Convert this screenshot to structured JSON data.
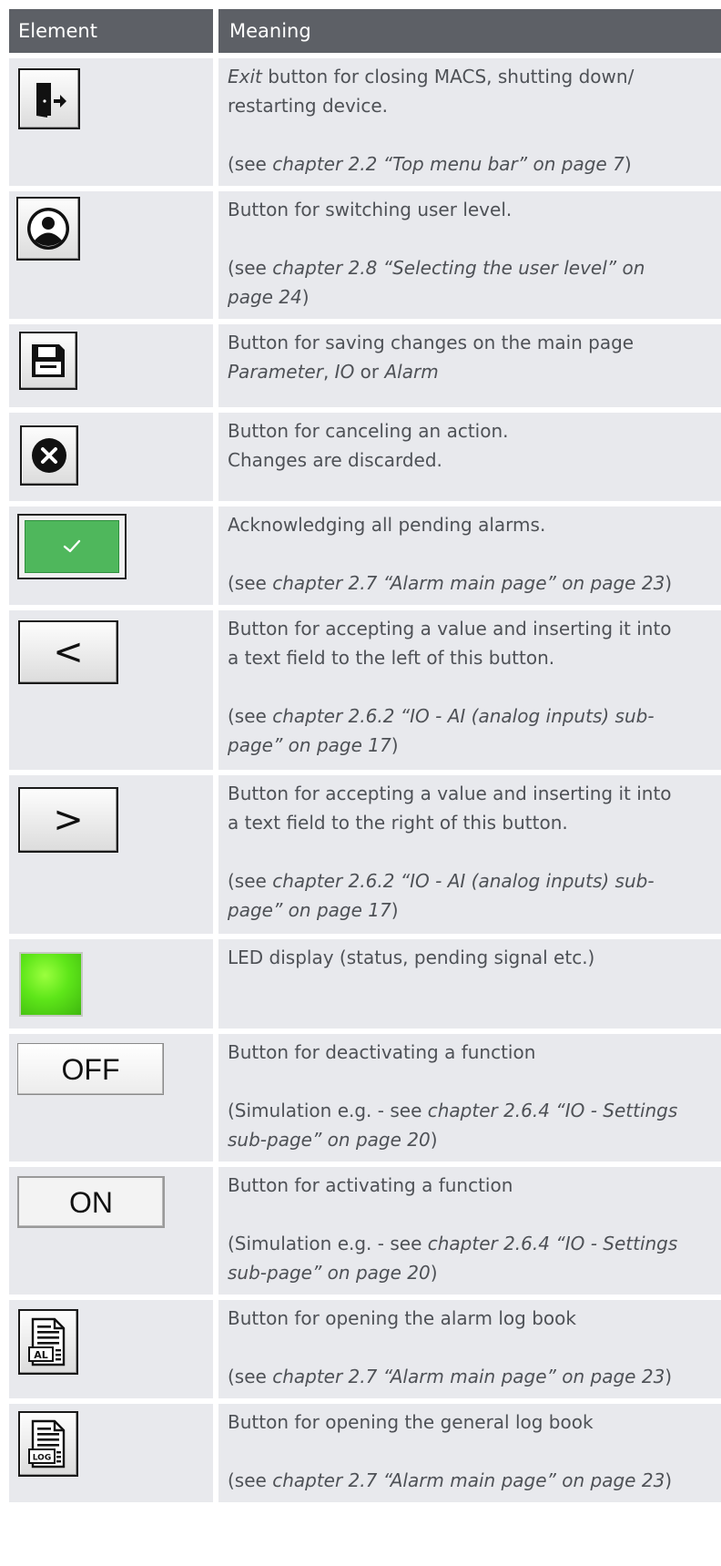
{
  "header": {
    "col_element": "Element",
    "col_meaning": "Meaning"
  },
  "rows": [
    {
      "icon": "exit-icon",
      "line1": [
        {
          "t": "Exit",
          "i": true
        },
        {
          "t": " button for closing MACS, shutting down/",
          "i": false
        }
      ],
      "line2": "restarting device.",
      "ref": [
        {
          "t": "(see ",
          "i": false
        },
        {
          "t": "chapter 2.2 “Top menu bar” on page 7",
          "i": true
        },
        {
          "t": ")",
          "i": false
        }
      ]
    },
    {
      "icon": "user-level-icon",
      "line1": "Button for switching user level.",
      "ref_a": [
        {
          "t": "(see ",
          "i": false
        },
        {
          "t": "chapter 2.8 “Selecting the user level” on",
          "i": true
        }
      ],
      "ref_b": [
        {
          "t": "page 24",
          "i": true
        },
        {
          "t": ")",
          "i": false
        }
      ]
    },
    {
      "icon": "save-icon",
      "line1": "Button for saving changes on the main page",
      "line2": [
        {
          "t": "Parameter",
          "i": true
        },
        {
          "t": ", ",
          "i": false
        },
        {
          "t": "IO",
          "i": true
        },
        {
          "t": " or ",
          "i": false
        },
        {
          "t": "Alarm",
          "i": true
        }
      ]
    },
    {
      "icon": "cancel-icon",
      "line1": "Button for canceling an action.",
      "line2": "Changes are discarded."
    },
    {
      "icon": "acknowledge-icon",
      "line1": "Acknowledging all pending alarms.",
      "ref": [
        {
          "t": "(see ",
          "i": false
        },
        {
          "t": "chapter 2.7 “Alarm main page” on page 23",
          "i": true
        },
        {
          "t": ")",
          "i": false
        }
      ]
    },
    {
      "icon": "insert-left-icon",
      "glyph": "<",
      "line1": "Button for accepting a value and inserting it into",
      "line2": "a text field to the left of this button.",
      "ref_a": [
        {
          "t": "(see ",
          "i": false
        },
        {
          "t": "chapter 2.6.2 “IO - AI (analog inputs) sub-",
          "i": true
        }
      ],
      "ref_b": [
        {
          "t": "page” on page 17",
          "i": true
        },
        {
          "t": ")",
          "i": false
        }
      ]
    },
    {
      "icon": "insert-right-icon",
      "glyph": ">",
      "line1": "Button for accepting a value and inserting it into",
      "line2": "a text field to the right of this button.",
      "ref_a": [
        {
          "t": "(see ",
          "i": false
        },
        {
          "t": "chapter 2.6.2 “IO - AI (analog inputs) sub-",
          "i": true
        }
      ],
      "ref_b": [
        {
          "t": "page” on page 17",
          "i": true
        },
        {
          "t": ")",
          "i": false
        }
      ]
    },
    {
      "icon": "led-icon",
      "led_color": "#5ee619",
      "line1": "LED display (status, pending signal etc.)"
    },
    {
      "icon": "off-button",
      "label": "OFF",
      "line1": "Button for deactivating a function",
      "ref_a": [
        {
          "t": "(Simulation e.g. - see ",
          "i": false
        },
        {
          "t": "chapter 2.6.4 “IO - Settings",
          "i": true
        }
      ],
      "ref_b": [
        {
          "t": "sub-page” on page 20",
          "i": true
        },
        {
          "t": ")",
          "i": false
        }
      ]
    },
    {
      "icon": "on-button",
      "label": "ON",
      "line1": "Button for activating a function",
      "ref_a": [
        {
          "t": "(Simulation e.g. - see ",
          "i": false
        },
        {
          "t": "chapter 2.6.4 “IO - Settings",
          "i": true
        }
      ],
      "ref_b": [
        {
          "t": "sub-page” on page 20",
          "i": true
        },
        {
          "t": ")",
          "i": false
        }
      ]
    },
    {
      "icon": "alarm-log-icon",
      "badge": "AL",
      "line1": "Button for opening the alarm log book",
      "ref": [
        {
          "t": "(see ",
          "i": false
        },
        {
          "t": "chapter 2.7 “Alarm main page” on page 23",
          "i": true
        },
        {
          "t": ")",
          "i": false
        }
      ]
    },
    {
      "icon": "general-log-icon",
      "badge": "LOG",
      "line1": "Button for opening the general log book",
      "ref": [
        {
          "t": "(see ",
          "i": false
        },
        {
          "t": "chapter 2.7 “Alarm main page” on page 23",
          "i": true
        },
        {
          "t": ")",
          "i": false
        }
      ]
    }
  ],
  "colors": {
    "header_bg": "#5d6066",
    "row_bg": "#e8e9ed",
    "text": "#4e5156",
    "ack_green": "#4fb75c"
  }
}
